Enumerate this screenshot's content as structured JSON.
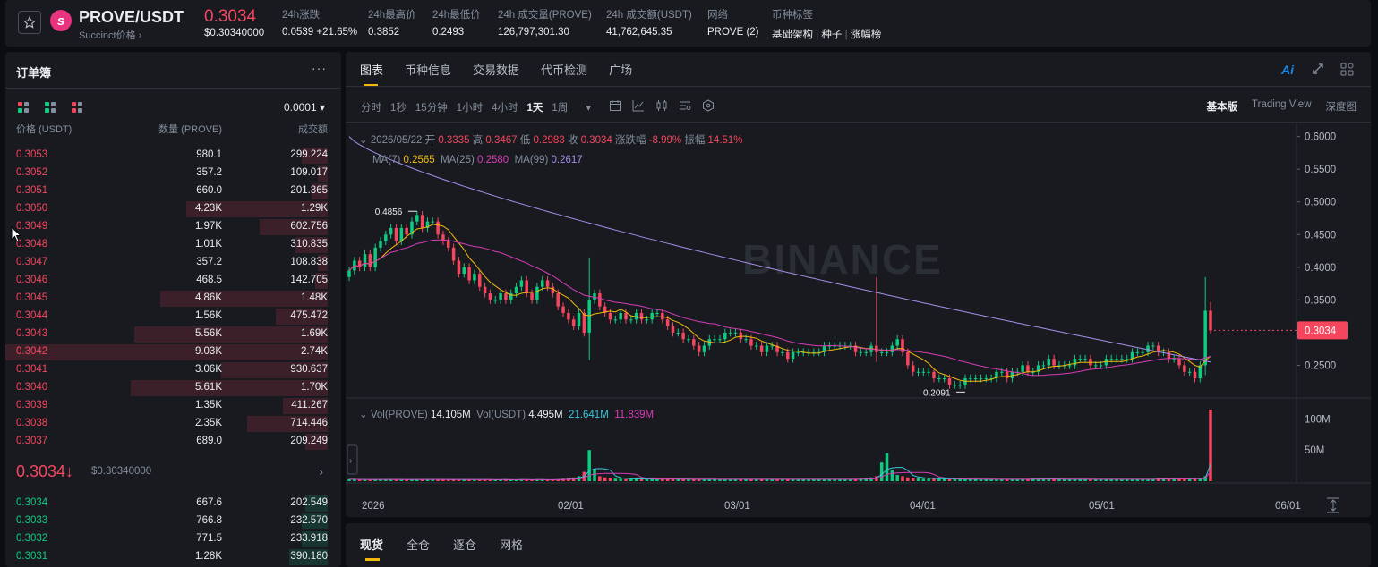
{
  "header": {
    "pair": "PROVE/USDT",
    "sub": "Succinct价格 ›",
    "price": "0.3034",
    "price_usd": "$0.30340000",
    "change_label": "24h涨跌",
    "change_value": "0.0539 +21.65%",
    "high_label": "24h最高价",
    "high_value": "0.3852",
    "low_label": "24h最低价",
    "low_value": "0.2493",
    "vol_label": "24h 成交量(PROVE)",
    "vol_value": "126,797,301.30",
    "turnover_label": "24h 成交额(USDT)",
    "turnover_value": "41,762,645.35",
    "network_label": "网络",
    "network_value": "PROVE (2)",
    "tags_label": "币种标签",
    "tags": [
      "基础架构",
      "种子",
      "涨幅榜"
    ]
  },
  "orderbook": {
    "title": "订单簿",
    "more": "···",
    "precision": "0.0001 ▾",
    "col_price": "价格 (USDT)",
    "col_qty": "数量 (PROVE)",
    "col_total": "成交额",
    "asks": [
      {
        "p": "0.3053",
        "q": "980.1",
        "t": "299.224",
        "d": 0.08
      },
      {
        "p": "0.3052",
        "q": "357.2",
        "t": "109.017",
        "d": 0.03
      },
      {
        "p": "0.3051",
        "q": "660.0",
        "t": "201.365",
        "d": 0.05
      },
      {
        "p": "0.3050",
        "q": "4.23K",
        "t": "1.29K",
        "d": 0.44
      },
      {
        "p": "0.3049",
        "q": "1.97K",
        "t": "602.756",
        "d": 0.21
      },
      {
        "p": "0.3048",
        "q": "1.01K",
        "t": "310.835",
        "d": 0.1
      },
      {
        "p": "0.3047",
        "q": "357.2",
        "t": "108.838",
        "d": 0.03
      },
      {
        "p": "0.3046",
        "q": "468.5",
        "t": "142.705",
        "d": 0.04
      },
      {
        "p": "0.3045",
        "q": "4.86K",
        "t": "1.48K",
        "d": 0.52
      },
      {
        "p": "0.3044",
        "q": "1.56K",
        "t": "475.472",
        "d": 0.16
      },
      {
        "p": "0.3043",
        "q": "5.56K",
        "t": "1.69K",
        "d": 0.6
      },
      {
        "p": "0.3042",
        "q": "9.03K",
        "t": "2.74K",
        "d": 1.0
      },
      {
        "p": "0.3041",
        "q": "3.06K",
        "t": "930.637",
        "d": 0.33
      },
      {
        "p": "0.3040",
        "q": "5.61K",
        "t": "1.70K",
        "d": 0.61
      },
      {
        "p": "0.3039",
        "q": "1.35K",
        "t": "411.267",
        "d": 0.14
      },
      {
        "p": "0.3038",
        "q": "2.35K",
        "t": "714.446",
        "d": 0.25
      },
      {
        "p": "0.3037",
        "q": "689.0",
        "t": "209.249",
        "d": 0.07
      }
    ],
    "mid_price": "0.3034↓",
    "mid_usd": "$0.30340000",
    "bids": [
      {
        "p": "0.3034",
        "q": "667.6",
        "t": "202.549",
        "d": 0.07
      },
      {
        "p": "0.3033",
        "q": "766.8",
        "t": "232.570",
        "d": 0.08
      },
      {
        "p": "0.3032",
        "q": "771.5",
        "t": "233.918",
        "d": 0.08
      },
      {
        "p": "0.3031",
        "q": "1.28K",
        "t": "390.180",
        "d": 0.12
      }
    ]
  },
  "chart_tabs": [
    "图表",
    "币种信息",
    "交易数据",
    "代币检测",
    "广场"
  ],
  "intervals": [
    "分时",
    "1秒",
    "15分钟",
    "1小时",
    "4小时",
    "1天",
    "1周"
  ],
  "views": [
    "基本版",
    "Trading View",
    "深度图"
  ],
  "ohlc": {
    "date": "2026/05/22",
    "open_label": "开",
    "open": "0.3335",
    "high_label": "高",
    "high": "0.3467",
    "low_label": "低",
    "low": "0.2983",
    "close_label": "收",
    "close": "0.3034",
    "chg_label": "涨跌幅",
    "chg": "-8.99%",
    "amp_label": "振幅",
    "amp": "14.51%"
  },
  "ma": {
    "ma7_label": "MA(7)",
    "ma7": "0.2565",
    "ma25_label": "MA(25)",
    "ma25": "0.2580",
    "ma99_label": "MA(99)",
    "ma99": "0.2617"
  },
  "vol": {
    "prove_label": "Vol(PROVE)",
    "prove": "14.105M",
    "usdt_label": "Vol(USDT)",
    "usdt": "4.495M",
    "ma1": "21.641M",
    "ma2": "11.839M"
  },
  "watermark": "BINANCE",
  "bottom_tabs": [
    "现货",
    "全仓",
    "逐仓",
    "网格"
  ],
  "colors": {
    "up": "#0ecb81",
    "down": "#f6465d",
    "accent": "#f0b90b",
    "ma7": "#f0b90b",
    "ma25": "#d63db5",
    "ma99": "#a58ee8"
  },
  "chart_data": {
    "type": "candlestick",
    "x_ticks": [
      "2026",
      "02/01",
      "03/01",
      "04/01",
      "05/01",
      "06/01"
    ],
    "y_ticks": [
      "0.6000",
      "0.5500",
      "0.5000",
      "0.4500",
      "0.4000",
      "0.3500",
      "0.3000",
      "0.2500"
    ],
    "ylim": [
      0.2,
      0.62
    ],
    "current_price": "0.3034",
    "annot_high": "0.4856",
    "annot_low": "0.2091",
    "vol_ticks": [
      "100M",
      "50M"
    ],
    "vol_max": 115,
    "closes": [
      0.395,
      0.41,
      0.4,
      0.42,
      0.4,
      0.43,
      0.44,
      0.45,
      0.46,
      0.44,
      0.46,
      0.45,
      0.47,
      0.48,
      0.46,
      0.47,
      0.47,
      0.45,
      0.44,
      0.43,
      0.41,
      0.39,
      0.4,
      0.38,
      0.39,
      0.37,
      0.36,
      0.35,
      0.35,
      0.36,
      0.35,
      0.36,
      0.37,
      0.38,
      0.36,
      0.35,
      0.37,
      0.38,
      0.37,
      0.36,
      0.34,
      0.33,
      0.32,
      0.31,
      0.33,
      0.3,
      0.35,
      0.36,
      0.34,
      0.33,
      0.32,
      0.32,
      0.33,
      0.32,
      0.32,
      0.33,
      0.32,
      0.32,
      0.33,
      0.33,
      0.32,
      0.31,
      0.3,
      0.3,
      0.29,
      0.29,
      0.28,
      0.27,
      0.28,
      0.29,
      0.29,
      0.29,
      0.3,
      0.3,
      0.3,
      0.29,
      0.29,
      0.28,
      0.28,
      0.27,
      0.28,
      0.28,
      0.27,
      0.27,
      0.26,
      0.27,
      0.27,
      0.27,
      0.27,
      0.27,
      0.27,
      0.28,
      0.28,
      0.28,
      0.28,
      0.28,
      0.28,
      0.27,
      0.27,
      0.27,
      0.28,
      0.27,
      0.27,
      0.27,
      0.28,
      0.29,
      0.27,
      0.25,
      0.24,
      0.24,
      0.24,
      0.24,
      0.23,
      0.23,
      0.23,
      0.22,
      0.22,
      0.22,
      0.23,
      0.23,
      0.23,
      0.23,
      0.23,
      0.23,
      0.24,
      0.24,
      0.23,
      0.24,
      0.24,
      0.25,
      0.24,
      0.24,
      0.25,
      0.25,
      0.26,
      0.25,
      0.25,
      0.25,
      0.25,
      0.26,
      0.26,
      0.26,
      0.25,
      0.25,
      0.25,
      0.26,
      0.26,
      0.26,
      0.26,
      0.26,
      0.27,
      0.27,
      0.27,
      0.28,
      0.28,
      0.27,
      0.27,
      0.26,
      0.26,
      0.25,
      0.24,
      0.24,
      0.23,
      0.25,
      0.3335,
      0.3034
    ],
    "volumes": [
      3,
      3,
      2,
      3,
      2,
      3,
      3,
      3,
      3,
      2,
      3,
      2,
      3,
      3,
      3,
      3,
      2,
      3,
      3,
      2,
      3,
      2,
      3,
      3,
      2,
      2,
      3,
      2,
      2,
      2,
      3,
      2,
      2,
      3,
      2,
      2,
      3,
      2,
      2,
      2,
      3,
      4,
      5,
      6,
      8,
      15,
      50,
      20,
      8,
      6,
      5,
      4,
      4,
      3,
      4,
      4,
      3,
      3,
      3,
      3,
      4,
      4,
      3,
      3,
      3,
      3,
      3,
      3,
      3,
      3,
      3,
      3,
      3,
      3,
      3,
      3,
      3,
      3,
      3,
      3,
      3,
      3,
      3,
      3,
      3,
      3,
      3,
      3,
      3,
      3,
      3,
      3,
      3,
      3,
      3,
      3,
      3,
      3,
      4,
      5,
      6,
      8,
      30,
      45,
      18,
      10,
      8,
      6,
      5,
      5,
      4,
      4,
      4,
      4,
      4,
      3,
      3,
      3,
      3,
      3,
      3,
      3,
      3,
      3,
      3,
      3,
      3,
      3,
      3,
      3,
      3,
      4,
      4,
      4,
      3,
      3,
      3,
      3,
      3,
      3,
      3,
      3,
      3,
      3,
      3,
      3,
      3,
      3,
      3,
      3,
      3,
      3,
      3,
      3,
      3,
      5,
      4,
      4,
      4,
      4,
      4,
      4,
      4,
      5,
      8,
      115,
      14
    ]
  }
}
